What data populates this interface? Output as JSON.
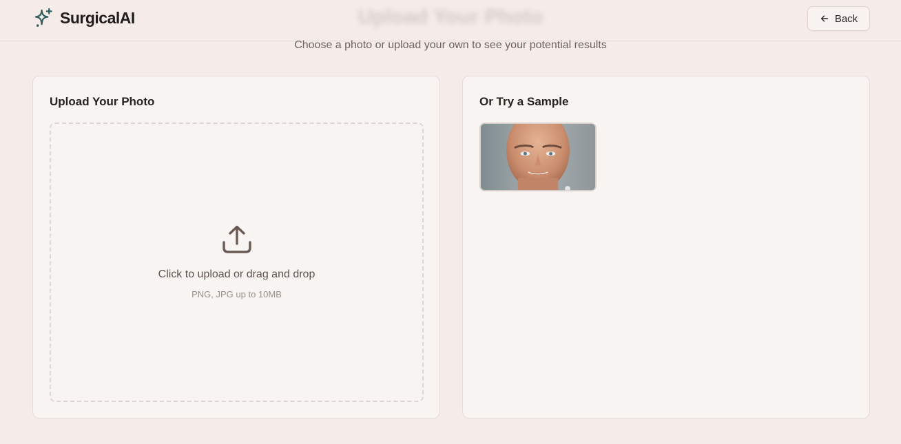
{
  "app": {
    "name": "SurgicalAI",
    "page_title": "Upload Your Photo",
    "subtitle": "Choose a photo or upload your own to see your potential results"
  },
  "header": {
    "back_label": "Back",
    "back_icon": "arrow-left-icon",
    "logo_icon": "sparkle-icon"
  },
  "upload_card": {
    "title": "Upload Your Photo",
    "dropzone_text": "Click to upload or drag and drop",
    "dropzone_hint": "PNG, JPG up to 10MB",
    "icon": "upload-icon"
  },
  "sample_card": {
    "title": "Or Try a Sample",
    "samples": [
      {
        "description": "sample face photo"
      }
    ]
  },
  "colors": {
    "background": "#f5ecea",
    "card": "#f8f4f1",
    "brand": "#2e5e5a"
  }
}
